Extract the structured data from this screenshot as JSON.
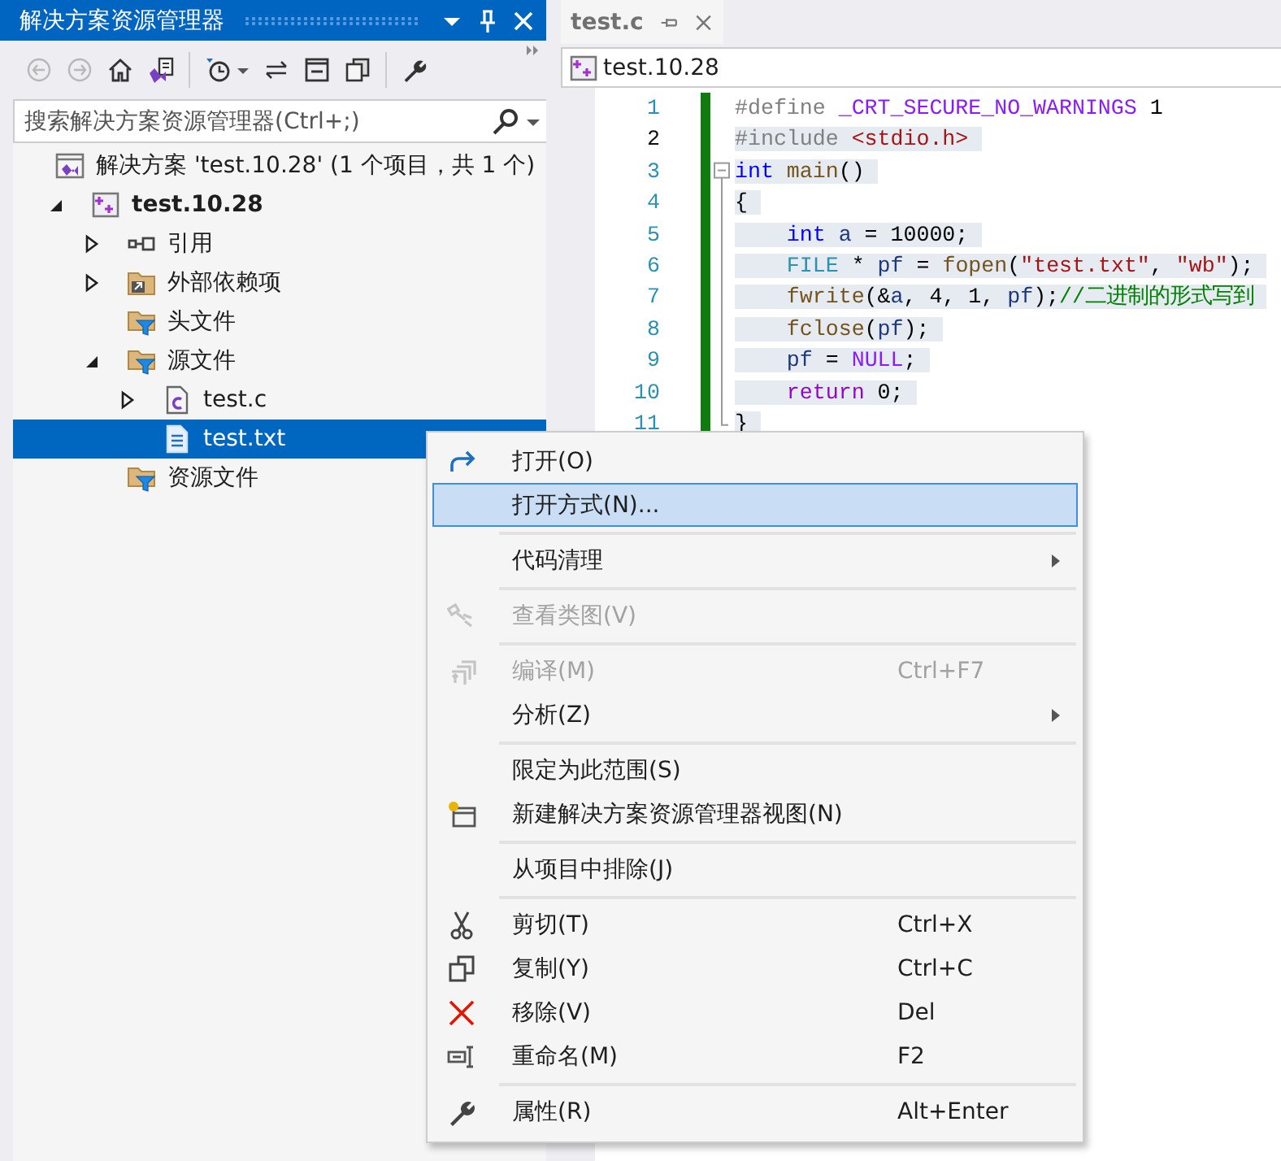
{
  "explorer": {
    "title": "解决方案资源管理器",
    "search": {
      "placeholder": "搜索解决方案资源管理器(Ctrl+;)"
    },
    "tree": [
      {
        "label": "解决方案 'test.10.28' (1 个项目，共 1 个)",
        "kind": "solution",
        "selected": false,
        "children": [
          {
            "label": "test.10.28",
            "kind": "project",
            "bold": true,
            "expanded": true,
            "selected": false,
            "children": [
              {
                "label": "引用",
                "kind": "references",
                "expanded": false,
                "selected": false
              },
              {
                "label": "外部依赖项",
                "kind": "external",
                "expanded": false,
                "selected": false
              },
              {
                "label": "头文件",
                "kind": "filter",
                "selected": false
              },
              {
                "label": "源文件",
                "kind": "filter",
                "expanded": true,
                "selected": false,
                "children": [
                  {
                    "label": "test.c",
                    "kind": "c-file",
                    "expanded": false,
                    "selected": false
                  },
                  {
                    "label": "test.txt",
                    "kind": "text-file",
                    "selected": true
                  }
                ]
              },
              {
                "label": "资源文件",
                "kind": "filter",
                "selected": false
              }
            ]
          }
        ]
      }
    ]
  },
  "editor": {
    "tab": {
      "label": "test.c",
      "selected": true
    },
    "nav_project": "test.10.28",
    "lines": [
      {
        "number": "1",
        "current": false,
        "highlighted": false,
        "tokens": [
          {
            "text": "#define ",
            "kind": "preproc"
          },
          {
            "text": "_CRT_SECURE_NO_WARNINGS",
            "kind": "macro"
          },
          {
            "text": " 1",
            "kind": "text"
          }
        ]
      },
      {
        "number": "2",
        "current": true,
        "highlighted": true,
        "tokens": [
          {
            "text": "#include ",
            "kind": "preproc"
          },
          {
            "text": "<stdio.h>",
            "kind": "string"
          }
        ]
      },
      {
        "number": "3",
        "current": false,
        "highlighted": true,
        "tokens": [
          {
            "text": "int",
            "kind": "keyword"
          },
          {
            "text": " main",
            "kind": "func"
          },
          {
            "text": "()",
            "kind": "text"
          }
        ]
      },
      {
        "number": "4",
        "current": false,
        "highlighted": true,
        "tokens": [
          {
            "text": "{",
            "kind": "text"
          }
        ]
      },
      {
        "number": "5",
        "current": false,
        "highlighted": true,
        "tokens": [
          {
            "text": "    int",
            "kind": "keyword"
          },
          {
            "text": " a",
            "kind": "var"
          },
          {
            "text": " = 10000;",
            "kind": "text"
          }
        ]
      },
      {
        "number": "6",
        "current": false,
        "highlighted": true,
        "tokens": [
          {
            "text": "    FILE",
            "kind": "type"
          },
          {
            "text": " * ",
            "kind": "text"
          },
          {
            "text": "pf",
            "kind": "var"
          },
          {
            "text": " = ",
            "kind": "text"
          },
          {
            "text": "fopen",
            "kind": "func"
          },
          {
            "text": "(",
            "kind": "text"
          },
          {
            "text": "\"test.txt\"",
            "kind": "string"
          },
          {
            "text": ", ",
            "kind": "text"
          },
          {
            "text": "\"wb\"",
            "kind": "string"
          },
          {
            "text": ");",
            "kind": "text"
          }
        ]
      },
      {
        "number": "7",
        "current": false,
        "highlighted": true,
        "tokens": [
          {
            "text": "    fwrite",
            "kind": "func"
          },
          {
            "text": "(&",
            "kind": "text"
          },
          {
            "text": "a",
            "kind": "var"
          },
          {
            "text": ", 4, 1, ",
            "kind": "text"
          },
          {
            "text": "pf",
            "kind": "var"
          },
          {
            "text": ");",
            "kind": "text"
          },
          {
            "text": "//二进制的形式写到",
            "kind": "comment"
          }
        ]
      },
      {
        "number": "8",
        "current": false,
        "highlighted": true,
        "tokens": [
          {
            "text": "    fclose",
            "kind": "func"
          },
          {
            "text": "(",
            "kind": "text"
          },
          {
            "text": "pf",
            "kind": "var"
          },
          {
            "text": ");",
            "kind": "text"
          }
        ]
      },
      {
        "number": "9",
        "current": false,
        "highlighted": true,
        "tokens": [
          {
            "text": "    pf",
            "kind": "var"
          },
          {
            "text": " = ",
            "kind": "text"
          },
          {
            "text": "NULL",
            "kind": "macro"
          },
          {
            "text": ";",
            "kind": "text"
          }
        ]
      },
      {
        "number": "10",
        "current": false,
        "highlighted": true,
        "tokens": [
          {
            "text": "    return",
            "kind": "control"
          },
          {
            "text": " 0;",
            "kind": "text"
          }
        ]
      },
      {
        "number": "11",
        "current": false,
        "highlighted": true,
        "tokens": [
          {
            "text": "}",
            "kind": "text"
          }
        ]
      }
    ]
  },
  "context_menu": {
    "items": [
      {
        "kind": "item",
        "label": "打开(O)",
        "disabled": false,
        "selected": false
      },
      {
        "kind": "item",
        "label": "打开方式(N)...",
        "disabled": false,
        "selected": true
      },
      {
        "kind": "separator"
      },
      {
        "kind": "item",
        "label": "代码清理",
        "disabled": false,
        "selected": false,
        "submenu": true
      },
      {
        "kind": "separator"
      },
      {
        "kind": "item",
        "label": "查看类图(V)",
        "disabled": true,
        "selected": false
      },
      {
        "kind": "separator"
      },
      {
        "kind": "item",
        "label": "编译(M)",
        "shortcut": "Ctrl+F7",
        "disabled": true,
        "selected": false
      },
      {
        "kind": "item",
        "label": "分析(Z)",
        "disabled": false,
        "selected": false,
        "submenu": true
      },
      {
        "kind": "separator"
      },
      {
        "kind": "item",
        "label": "限定为此范围(S)",
        "disabled": false,
        "selected": false
      },
      {
        "kind": "item",
        "label": "新建解决方案资源管理器视图(N)",
        "disabled": false,
        "selected": false
      },
      {
        "kind": "separator"
      },
      {
        "kind": "item",
        "label": "从项目中排除(J)",
        "disabled": false,
        "selected": false
      },
      {
        "kind": "separator"
      },
      {
        "kind": "item",
        "label": "剪切(T)",
        "shortcut": "Ctrl+X",
        "disabled": false,
        "selected": false
      },
      {
        "kind": "item",
        "label": "复制(Y)",
        "shortcut": "Ctrl+C",
        "disabled": false,
        "selected": false
      },
      {
        "kind": "item",
        "label": "移除(V)",
        "shortcut": "Del",
        "disabled": false,
        "selected": false
      },
      {
        "kind": "item",
        "label": "重命名(M)",
        "shortcut": "F2",
        "disabled": false,
        "selected": false
      },
      {
        "kind": "separator"
      },
      {
        "kind": "item",
        "label": "属性(R)",
        "shortcut": "Alt+Enter",
        "disabled": false,
        "selected": false
      }
    ]
  }
}
